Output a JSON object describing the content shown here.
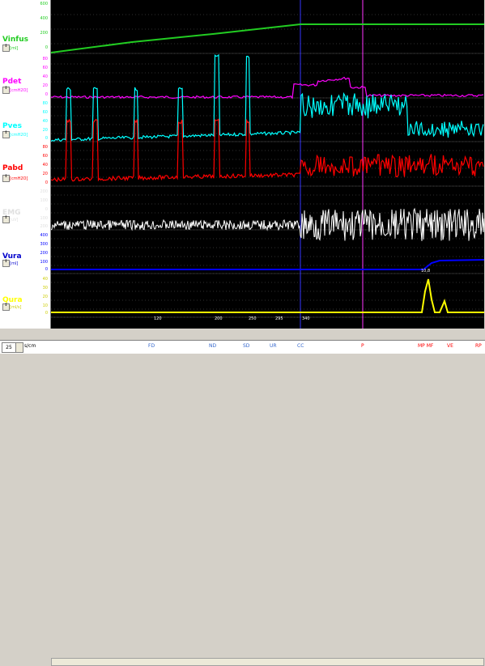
{
  "channels": [
    {
      "id": "vinfus",
      "name": "Vinfus",
      "unit": "[ml]",
      "color": "#22cc22",
      "ticks": [
        "600",
        "400",
        "200",
        "0"
      ]
    },
    {
      "id": "pdet",
      "name": "Pdet",
      "unit": "[cmH2O]",
      "color": "#ff00ff",
      "ticks": [
        "80",
        "60",
        "40",
        "20",
        "0"
      ]
    },
    {
      "id": "pves",
      "name": "Pves",
      "unit": "[cmH2O]",
      "color": "#00ffff",
      "ticks": [
        "80",
        "60",
        "40",
        "20",
        "0"
      ]
    },
    {
      "id": "pabd",
      "name": "Pabd",
      "unit": "[cmH2O]",
      "color": "#ff0000",
      "ticks": [
        "80",
        "60",
        "40",
        "20",
        "0"
      ]
    },
    {
      "id": "emg",
      "name": "EMG",
      "unit": "[uV]",
      "color": "#ffffff",
      "ticks": [
        "200",
        "100",
        "0",
        "100",
        "200"
      ]
    },
    {
      "id": "vura",
      "name": "Vura",
      "unit": "[ml]",
      "color": "#0000ff",
      "ticks": [
        "400",
        "300",
        "200",
        "100",
        "0"
      ]
    },
    {
      "id": "qura",
      "name": "Qura",
      "unit": "[ml/s]",
      "color": "#ffff00",
      "ticks": [
        "40",
        "30",
        "20",
        "10",
        "0"
      ]
    }
  ],
  "volume_markers": [
    "120",
    "200",
    "250",
    "295",
    "340"
  ],
  "flow_peak_label": "10,8",
  "speed": {
    "value": "25",
    "unit": "s/cm"
  },
  "events": [
    {
      "label": "FD",
      "red": false
    },
    {
      "label": "ND",
      "red": false
    },
    {
      "label": "SD",
      "red": false
    },
    {
      "label": "UR",
      "red": false
    },
    {
      "label": "CC",
      "red": false
    },
    {
      "label": "P",
      "red": true
    },
    {
      "label": "MP MF",
      "red": true
    },
    {
      "label": "VE",
      "red": true
    },
    {
      "label": "RP",
      "red": true
    }
  ]
}
